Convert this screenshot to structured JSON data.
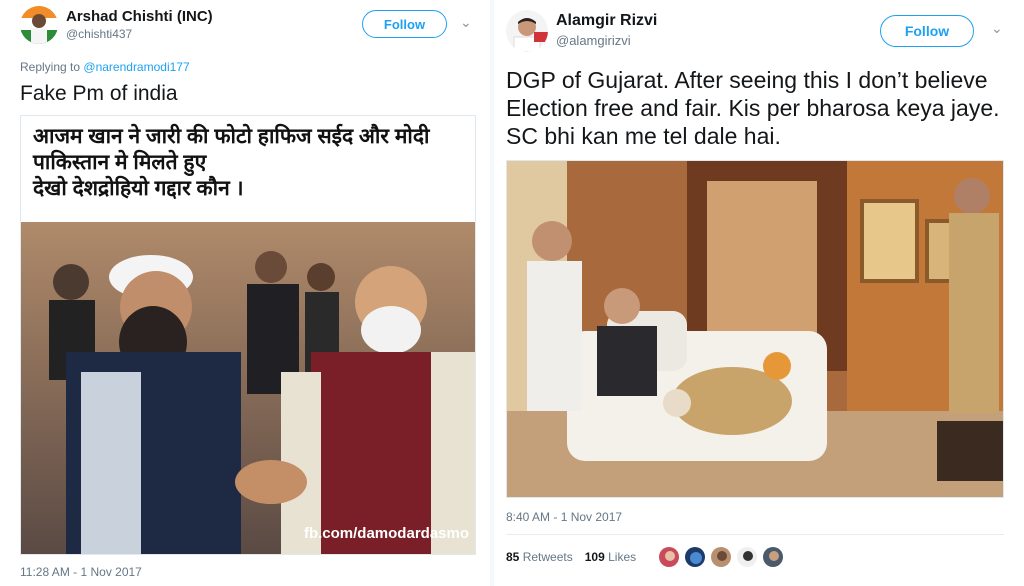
{
  "left_tweet": {
    "author_name": "Arshad Chishti (INC)",
    "author_handle": "@chishti437",
    "follow_label": "Follow",
    "chevron_icon": "chevron-down-icon",
    "replying_prefix": "Replying to",
    "replying_mention": "@narendramodi177",
    "text": "Fake Pm of india",
    "image_caption_lines": [
      "आजम खान ने जारी की फोटो हाफिज सईद और मोदी",
      "पाकिस्तान मे मिलते हुए",
      "देखो देशद्रोहियो गद्दार कौन ।"
    ],
    "watermark": "fb.com/damodardasmo",
    "timestamp": "11:28 AM - 1 Nov 2017"
  },
  "right_tweet": {
    "author_name": "Alamgir Rizvi",
    "author_handle": "@alamgirizvi",
    "follow_label": "Follow",
    "chevron_icon": "chevron-down-icon",
    "text": "DGP of Gujarat. After seeing this I don’t believe Election free and fair. Kis per bharosa keya jaye. SC bhi kan me tel dale hai.",
    "timestamp": "8:40 AM - 1 Nov 2017",
    "retweets_count": "85",
    "retweets_label": "Retweets",
    "likes_count": "109",
    "likes_label": "Likes"
  },
  "colors": {
    "accent": "#1da1f2",
    "secondary_text": "#657786",
    "primary_text": "#14171a"
  }
}
